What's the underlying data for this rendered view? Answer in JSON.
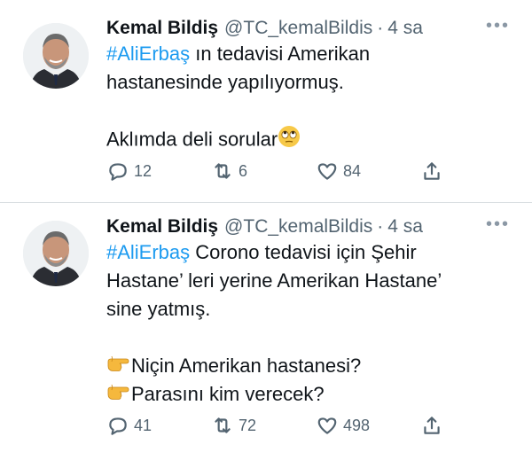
{
  "tweets": [
    {
      "name": "Kemal Bildiş",
      "handle": "@TC_kemalBildis",
      "time": "4 sa",
      "hashtag": "#AliErbaş",
      "line1_rest": " ın tedavisi Amerikan",
      "line2": "hastanesinde yapılıyormuş.",
      "line4": "Aklımda deli sorular",
      "emoji": "eye-roll-emoji",
      "replies": "12",
      "retweets": "6",
      "likes": "84"
    },
    {
      "name": "Kemal Bildiş",
      "handle": "@TC_kemalBildis",
      "time": "4 sa",
      "hashtag": "#AliErbaş",
      "line1_rest": " Corono tedavisi için Şehir",
      "line2": "Hastane’ leri yerine Amerikan Hastane’",
      "line3": "sine yatmış.",
      "line5": "Niçin Amerikan hastanesi?",
      "line6": "Parasını kim verecek?",
      "emoji": "pointing-hand-emoji",
      "replies": "41",
      "retweets": "72",
      "likes": "498"
    }
  ],
  "icons": {
    "more": "more-icon",
    "reply": "reply-icon",
    "retweet": "retweet-icon",
    "like": "heart-icon",
    "share": "share-icon"
  },
  "colors": {
    "link": "#1d9bf0",
    "secondary": "#536471",
    "text": "#0f1419"
  }
}
